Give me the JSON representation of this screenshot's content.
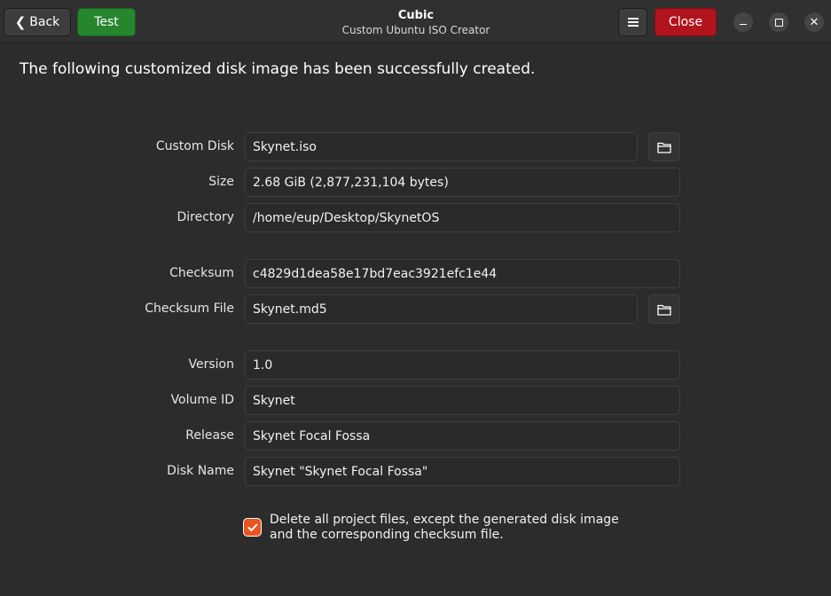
{
  "header": {
    "back_label": "Back",
    "test_label": "Test",
    "close_label": "Close",
    "title": "Cubic",
    "subtitle": "Custom Ubuntu ISO Creator"
  },
  "main": {
    "message": "The following customized disk image has been successfully created.",
    "fields": {
      "custom_disk": {
        "label": "Custom Disk",
        "value": "Skynet.iso"
      },
      "size": {
        "label": "Size",
        "value": "2.68 GiB (2,877,231,104 bytes)"
      },
      "directory": {
        "label": "Directory",
        "value": "/home/eup/Desktop/SkynetOS"
      },
      "checksum": {
        "label": "Checksum",
        "value": "c4829d1dea58e17bd7eac3921efc1e44"
      },
      "checksum_file": {
        "label": "Checksum File",
        "value": "Skynet.md5"
      },
      "version": {
        "label": "Version",
        "value": "1.0"
      },
      "volume_id": {
        "label": "Volume ID",
        "value": "Skynet"
      },
      "release": {
        "label": "Release",
        "value": "Skynet Focal Fossa"
      },
      "disk_name": {
        "label": "Disk Name",
        "value": "Skynet \"Skynet Focal Fossa\""
      }
    },
    "delete_option": {
      "checked": true,
      "label": "Delete all project files, except the generated disk image and the corresponding checksum file."
    }
  },
  "colors": {
    "test_button": "#26862e",
    "close_button": "#b2141e",
    "checkbox_accent": "#e95420"
  },
  "icons": {
    "back": "chevron-left-icon",
    "menu": "hamburger-menu-icon",
    "folder": "folder-icon",
    "minimize": "minimize-icon",
    "maximize": "maximize-icon",
    "close": "close-icon",
    "check": "checkmark-icon"
  }
}
